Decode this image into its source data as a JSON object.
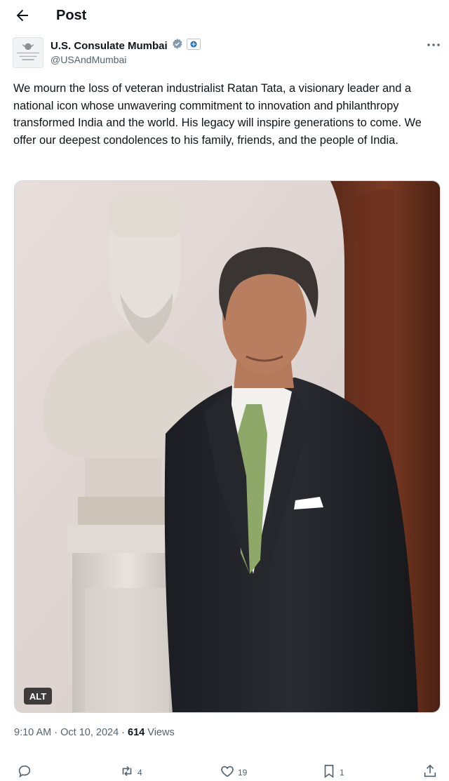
{
  "header": {
    "title": "Post"
  },
  "author": {
    "name": "U.S. Consulate Mumbai",
    "handle": "@USAndMumbai",
    "avatar_text": "U.S. CONSULATE Mumbai",
    "verified_icon": "verified-badge-icon",
    "affiliate_icon": "government-flag-icon"
  },
  "post": {
    "text": "We mourn the loss of veteran industrialist Ratan Tata, a visionary leader and a national icon whose unwavering commitment to innovation and philanthropy transformed India and the world. His legacy will inspire generations to come. We offer our deepest condolences to his family, friends, and the people of India.",
    "alt_label": "ALT"
  },
  "meta": {
    "time": "9:10 AM",
    "separator": "·",
    "date": "Oct 10, 2024",
    "views_count": "614",
    "views_label": "Views"
  },
  "actions": {
    "replies": "",
    "reposts": "4",
    "likes": "19",
    "bookmarks": "1"
  },
  "colors": {
    "text": "#0f1419",
    "secondary": "#536471",
    "accent": "#1d9bf0"
  }
}
